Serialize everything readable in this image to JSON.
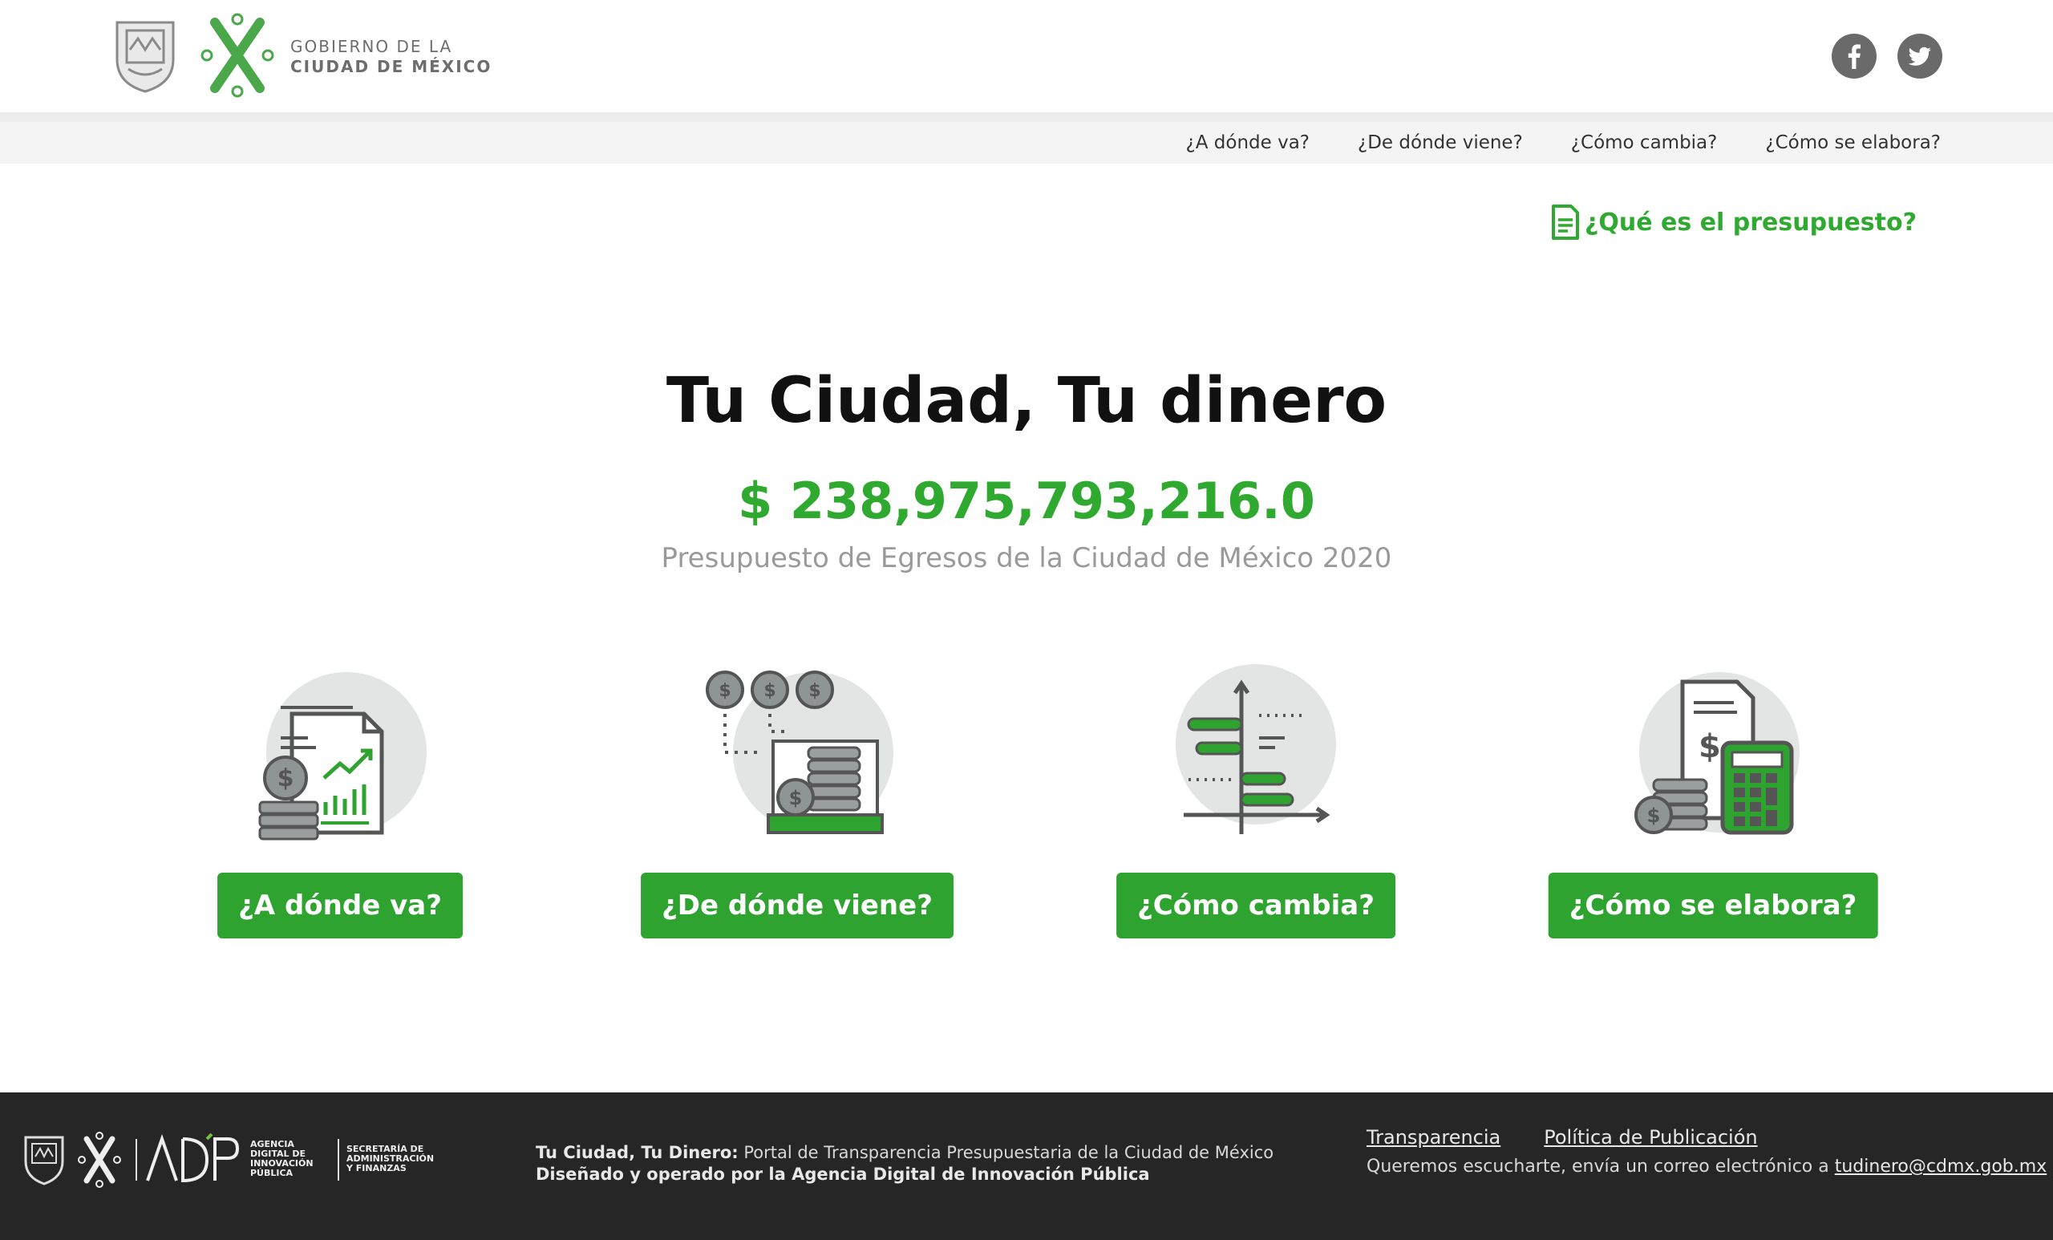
{
  "header": {
    "gov_line1": "GOBIERNO DE LA",
    "gov_line2": "CIUDAD DE MÉXICO",
    "social": [
      {
        "name": "facebook-icon"
      },
      {
        "name": "twitter-icon"
      }
    ]
  },
  "nav": {
    "items": [
      {
        "label": "¿A dónde va?"
      },
      {
        "label": "¿De dónde viene?"
      },
      {
        "label": "¿Cómo cambia?"
      },
      {
        "label": "¿Cómo se elabora?"
      }
    ]
  },
  "que_es": {
    "label": "¿Qué es el presupuesto?",
    "icon": "document-icon"
  },
  "hero": {
    "title": "Tu Ciudad, Tu dinero",
    "amount": "$ 238,975,793,216.0",
    "subtitle": "Presupuesto de Egresos de la Ciudad de México 2020"
  },
  "cards": [
    {
      "label": "¿A dónde va?",
      "icon": "report-chart-icon"
    },
    {
      "label": "¿De dónde viene?",
      "icon": "coins-flow-icon"
    },
    {
      "label": "¿Cómo cambia?",
      "icon": "bar-chart-axis-icon"
    },
    {
      "label": "¿Cómo se elabora?",
      "icon": "calculator-icon"
    }
  ],
  "footer": {
    "agency_lines": [
      "AGENCIA",
      "DIGITAL DE",
      "INNOVACIÓN",
      "PÚBLICA"
    ],
    "secretaria_lines": [
      "SECRETARÍA DE",
      "ADMINISTRACIÓN",
      "Y FINANZAS"
    ],
    "brand": "Tu Ciudad, Tu Dinero:",
    "description": " Portal de Transparencia Presupuestaria de la Ciudad de México",
    "operated_by": "Diseñado y operado por la Agencia Digital de Innovación Pública",
    "links": [
      {
        "label": "Transparencia"
      },
      {
        "label": "Política de Publicación"
      }
    ],
    "listen_text": "Queremos escucharte, envía un correo electrónico a ",
    "email": "tudinero@cdmx.gob.mx"
  },
  "colors": {
    "accent": "#2fa32f",
    "footer_bg": "#262626",
    "gray_icon": "#6a6a6a"
  }
}
